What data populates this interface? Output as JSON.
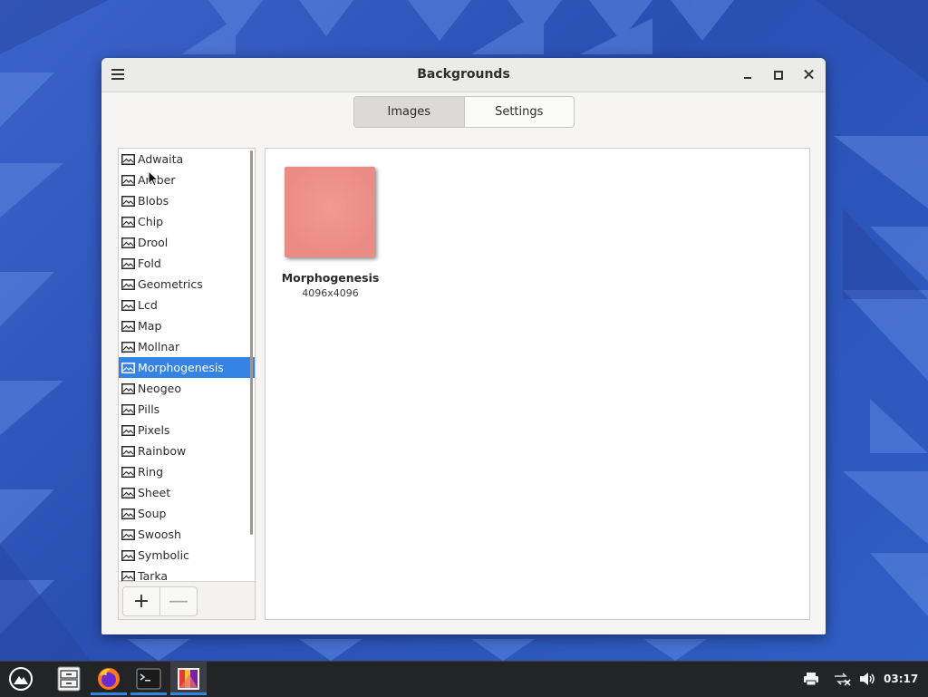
{
  "window": {
    "title": "Backgrounds",
    "tabs": [
      {
        "label": "Images",
        "active": true
      },
      {
        "label": "Settings",
        "active": false
      }
    ]
  },
  "backgrounds_list": {
    "items": [
      "Adwaita",
      "Amber",
      "Blobs",
      "Chip",
      "Drool",
      "Fold",
      "Geometrics",
      "Lcd",
      "Map",
      "Mollnar",
      "Morphogenesis",
      "Neogeo",
      "Pills",
      "Pixels",
      "Rainbow",
      "Ring",
      "Sheet",
      "Soup",
      "Swoosh",
      "Symbolic",
      "Tarka"
    ],
    "selected": "Morphogenesis",
    "add_label": "+",
    "remove_label": "—"
  },
  "images": [
    {
      "name": "Morphogenesis",
      "dimensions": "4096x4096",
      "color": "#ea8c84"
    }
  ],
  "taskbar": {
    "apps": [
      "launcher-icon",
      "file-manager-icon",
      "firefox-icon",
      "terminal-icon",
      "backgrounds-app-icon"
    ],
    "tray": [
      "printer-icon",
      "network-disconnected-icon",
      "volume-icon"
    ],
    "clock": "03:17"
  },
  "colors": {
    "accent": "#3584e4",
    "desktop": "#2f55b8"
  }
}
